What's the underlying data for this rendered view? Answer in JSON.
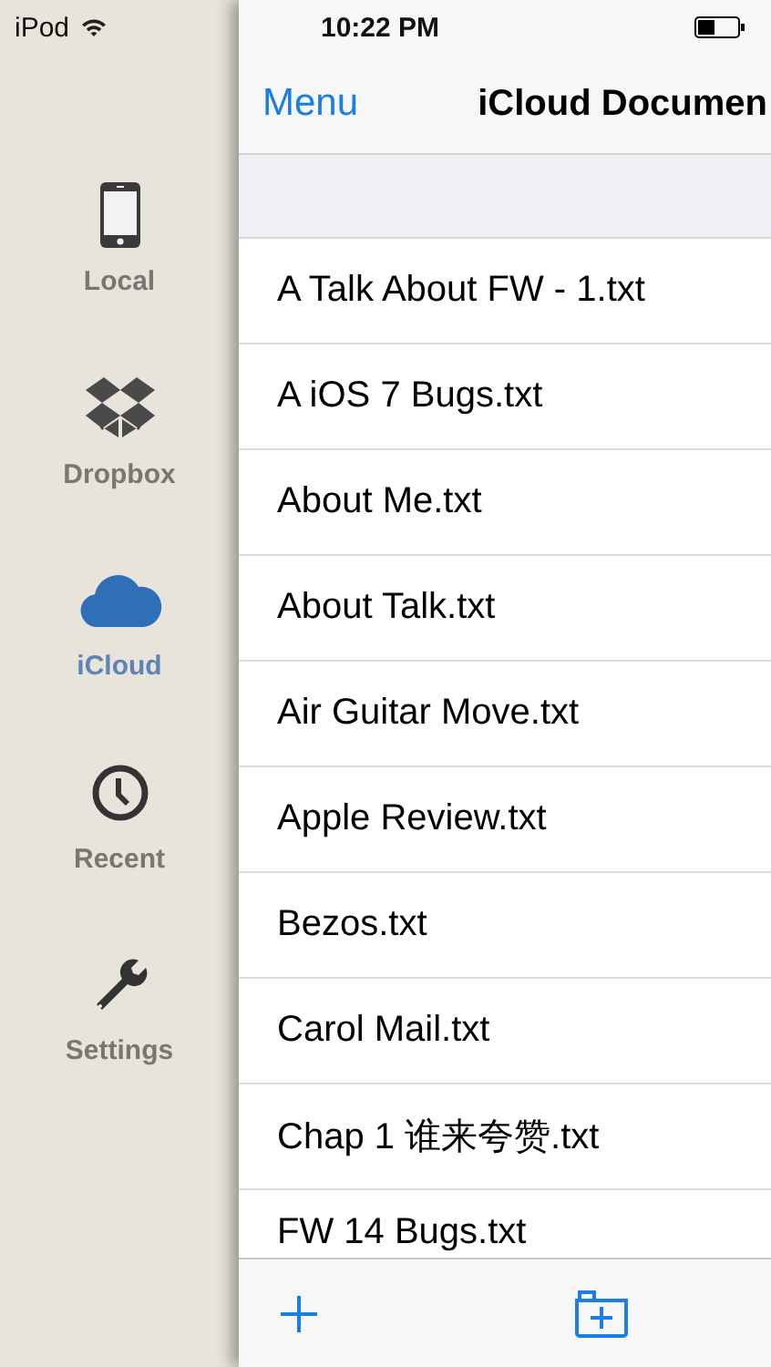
{
  "status_bar": {
    "carrier": "iPod",
    "time": "10:22 PM"
  },
  "sidebar": {
    "items": [
      {
        "kind": "phone",
        "label": "Local",
        "selected": false
      },
      {
        "kind": "box",
        "label": "Dropbox",
        "selected": false
      },
      {
        "kind": "cloud",
        "label": "iCloud",
        "selected": true
      },
      {
        "kind": "clock",
        "label": "Recent",
        "selected": false
      },
      {
        "kind": "wrench",
        "label": "Settings",
        "selected": false
      }
    ]
  },
  "nav_bar": {
    "back": "Menu",
    "title": "iCloud Documen"
  },
  "files": [
    "A Talk About FW - 1.txt",
    "A iOS 7 Bugs.txt",
    "About Me.txt",
    "About Talk.txt",
    "Air Guitar Move.txt",
    "Apple Review.txt",
    "Bezos.txt",
    "Carol Mail.txt",
    "Chap 1 谁来夸赞.txt",
    "FW 14 Bugs.txt"
  ]
}
